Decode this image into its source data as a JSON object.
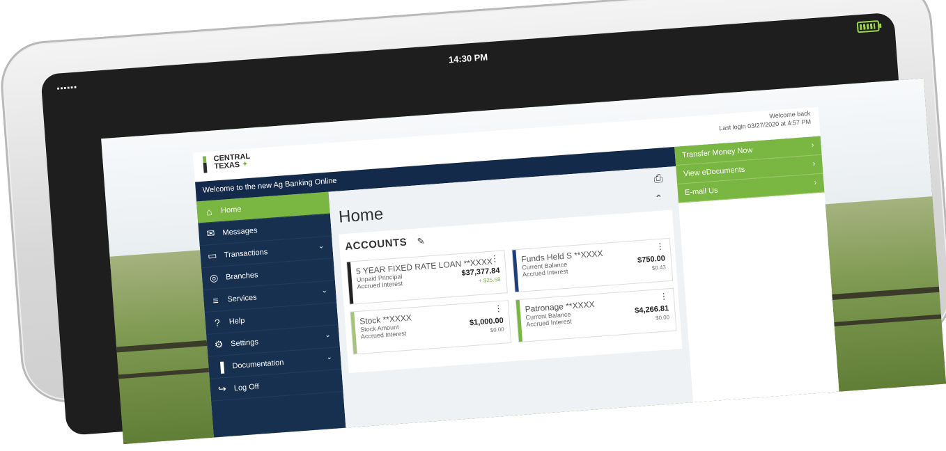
{
  "status_bar": {
    "signal": "▪▪▪▪▪▪",
    "time": "14:30 PM"
  },
  "app": {
    "logo_line1": "CENTRAL",
    "logo_line2": "TEXAS",
    "logo_plus": "✦",
    "welcome_text": "Welcome to the new Ag Banking Online",
    "welcome_back": "Welcome back",
    "last_login": "Last login 03/27/2020 at 4:57 PM",
    "close_icon": "×",
    "print_icon": "⎙",
    "collapse_icon": "⌃",
    "page_title": "Home"
  },
  "sidebar": {
    "items": [
      {
        "label": "Home",
        "icon": "⌂",
        "icon_name": "home-icon",
        "caret": ""
      },
      {
        "label": "Messages",
        "icon": "✉",
        "icon_name": "messages-icon",
        "caret": ""
      },
      {
        "label": "Transactions",
        "icon": "▭",
        "icon_name": "transactions-icon",
        "caret": "⌄"
      },
      {
        "label": "Branches",
        "icon": "◎",
        "icon_name": "branches-icon",
        "caret": ""
      },
      {
        "label": "Services",
        "icon": "≡",
        "icon_name": "services-icon",
        "caret": "⌄"
      },
      {
        "label": "Help",
        "icon": "?",
        "icon_name": "help-icon",
        "caret": ""
      },
      {
        "label": "Settings",
        "icon": "⚙",
        "icon_name": "settings-icon",
        "caret": "⌄"
      },
      {
        "label": "Documentation",
        "icon": "▐",
        "icon_name": "documentation-icon",
        "caret": "⌄"
      },
      {
        "label": "Log Off",
        "icon": "↪",
        "icon_name": "log-off-icon",
        "caret": ""
      }
    ]
  },
  "accounts": {
    "title": "ACCOUNTS",
    "edit_icon": "✎",
    "menu_icon": "⋮",
    "cards": [
      {
        "name": "5 YEAR FIXED RATE LOAN **XXXX",
        "line1": "Unpaid Principal",
        "line2": "Accrued Interest",
        "amount": "$37,377.84",
        "sub": "+ $25.58",
        "bar_color": "#222222"
      },
      {
        "name": "Funds Held S **XXXX",
        "line1": "Current Balance",
        "line2": "Accrued Interest",
        "amount": "$750.00",
        "sub": "$0.43",
        "bar_color": "#1f3f7a"
      },
      {
        "name": "Stock **XXXX",
        "line1": "Stock Amount",
        "line2": "Accrued Interest",
        "amount": "$1,000.00",
        "sub": "$0.00",
        "bar_color": "#a7c47d"
      },
      {
        "name": "Patronage **XXXX",
        "line1": "Current Balance",
        "line2": "Accrued Interest",
        "amount": "$4,266.81",
        "sub": "$0.00",
        "bar_color": "#7ab642"
      }
    ]
  },
  "quick_links": {
    "chevron": "›",
    "items": [
      "Transfer Money Now",
      "View eDocuments",
      "E-mail Us"
    ]
  }
}
